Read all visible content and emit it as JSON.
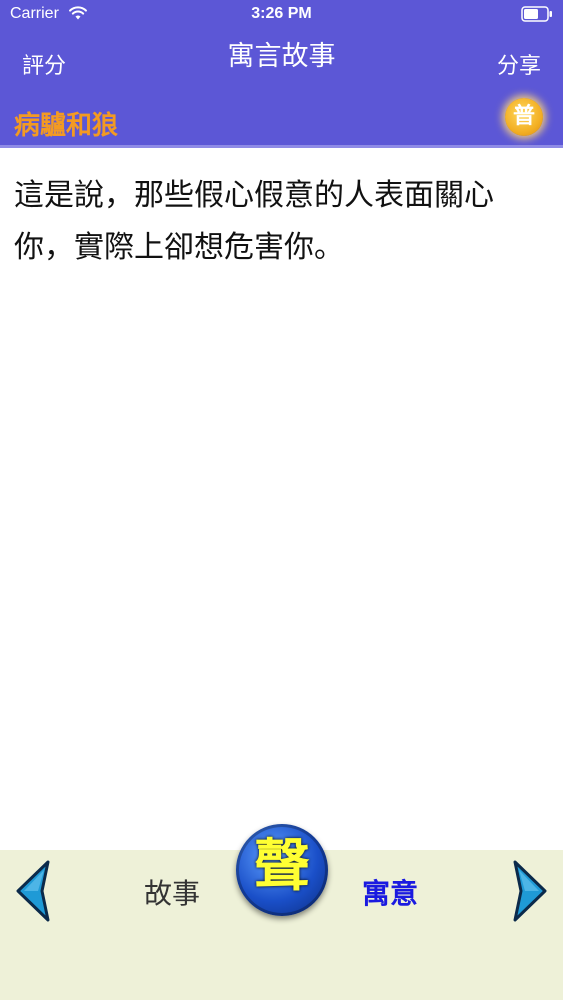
{
  "status_bar": {
    "carrier": "Carrier",
    "time": "3:26 PM"
  },
  "nav": {
    "left_label": "評分",
    "title": "寓言故事",
    "right_label": "分享"
  },
  "story": {
    "title": "病驢和狼",
    "badge": "普",
    "content": "這是說，那些假心假意的人表面關心你，實際上卻想危害你。"
  },
  "toolbar": {
    "story_tab": "故事",
    "sound_button": "聲",
    "moral_tab": "寓意"
  },
  "colors": {
    "header_bg": "#5c57d6",
    "story_title": "#f39a22",
    "active_tab": "#1a1ae0",
    "toolbar_bg": "#eef1d8",
    "sound_button": "#1a4fc8",
    "arrow": "#1f9ad6"
  }
}
